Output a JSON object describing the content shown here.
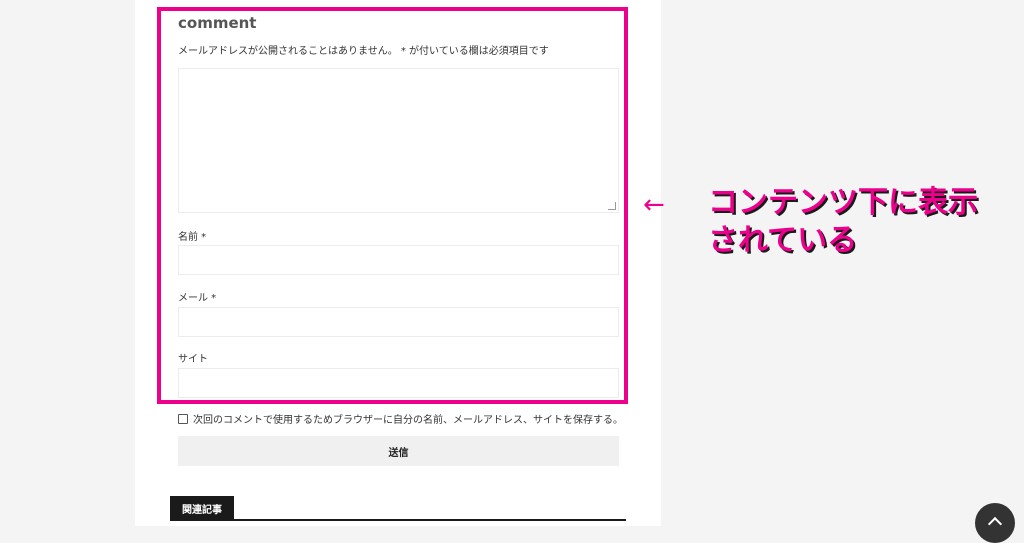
{
  "comment_form": {
    "title": "comment",
    "notes": "メールアドレスが公開されることはありません。 * が付いている欄は必須項目です",
    "comment_value": "",
    "name_label": "名前 *",
    "name_value": "",
    "email_label": "メール *",
    "email_value": "",
    "website_label": "サイト",
    "website_value": "",
    "cookie_consent_label": "次回のコメントで使用するためブラウザーに自分の名前、メールアドレス、サイトを保存する。",
    "cookie_consent_checked": false,
    "submit_label": "送信"
  },
  "related": {
    "heading": "関連記事"
  },
  "annotation": {
    "arrow": "←",
    "line1": "コンテンツ下に表示",
    "line2": "されている",
    "color": "#ec008c"
  },
  "icons": {
    "back_to_top": "chevron-up-icon",
    "resize": "resize-grip-icon"
  }
}
